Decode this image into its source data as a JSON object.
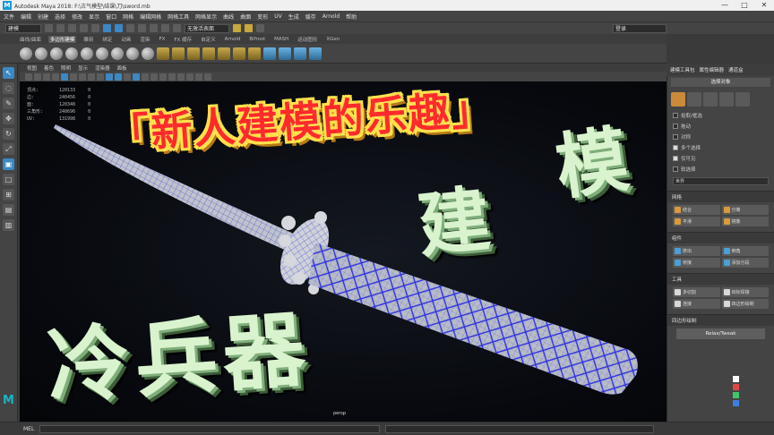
{
  "window": {
    "title": "Autodesk Maya 2018: F:\\古气模型\\结课\\刀\\sword.mb",
    "logo": "M",
    "min_label": "—",
    "max_label": "□",
    "close_label": "✕"
  },
  "menubar": {
    "items": [
      "文件",
      "编辑",
      "创建",
      "选择",
      "修改",
      "显示",
      "窗口",
      "网格",
      "编辑网格",
      "网格工具",
      "网格显示",
      "曲线",
      "曲面",
      "变形",
      "UV",
      "生成",
      "缓存",
      "Arnold",
      "帮助"
    ]
  },
  "statusline": {
    "mode": "建模",
    "no_live_surface": "无激活表面",
    "user": "登录"
  },
  "shelf": {
    "tabs": [
      "曲线/曲面",
      "多边形建模",
      "雕刻",
      "绑定",
      "动画",
      "渲染",
      "FX",
      "FX 缓存",
      "自定义",
      "Arnold",
      "Bifrost",
      "MASH",
      "运动图形",
      "XGen"
    ],
    "active_tab": "多边形建模"
  },
  "viewport": {
    "menu": [
      "视图",
      "着色",
      "照明",
      "显示",
      "渲染器",
      "面板"
    ],
    "hud": [
      {
        "label": "顶点:",
        "a": "120133",
        "b": "0"
      },
      {
        "label": "边:",
        "a": "240456",
        "b": "0"
      },
      {
        "label": "面:",
        "a": "120348",
        "b": "0"
      },
      {
        "label": "三角形:",
        "a": "240696",
        "b": "0"
      },
      {
        "label": "UV:",
        "a": "131998",
        "b": "0"
      }
    ],
    "camera": "persp"
  },
  "overlay": {
    "title": "「新人建模的乐趣」",
    "jian": "建",
    "mo": "模",
    "lengbingqi": "冷兵器"
  },
  "right_panel": {
    "top_tabs": [
      "建模工具包",
      "属性编辑器",
      "通道盒"
    ],
    "header": "选择对象",
    "rows": [
      {
        "label": "拾取/框选",
        "check": false
      },
      {
        "label": "拖动",
        "check": false
      },
      {
        "label": "对称",
        "check": false
      },
      {
        "label": "多个选择",
        "check": true
      },
      {
        "label": "仅可见",
        "check": true
      }
    ],
    "soft_select": "软选择",
    "axis_label": "世界",
    "sections": {
      "mesh": "网格",
      "components": "组件",
      "tools": "工具",
      "quad_draw": "四边形绘制"
    },
    "mesh_buttons": [
      "结合",
      "分离",
      "平滑",
      "镜像"
    ],
    "comp_buttons": [
      "挤出",
      "倒角",
      "桥接",
      "添加分段"
    ],
    "tool_buttons": [
      "多切割",
      "目标焊接",
      "连接",
      "四边形绘制"
    ],
    "big_button": "Relax/Tweak",
    "colors": [
      "#ffffff",
      "#e04848",
      "#44c46a",
      "#3f7de0"
    ]
  },
  "timebar": {
    "mel": "MEL"
  }
}
